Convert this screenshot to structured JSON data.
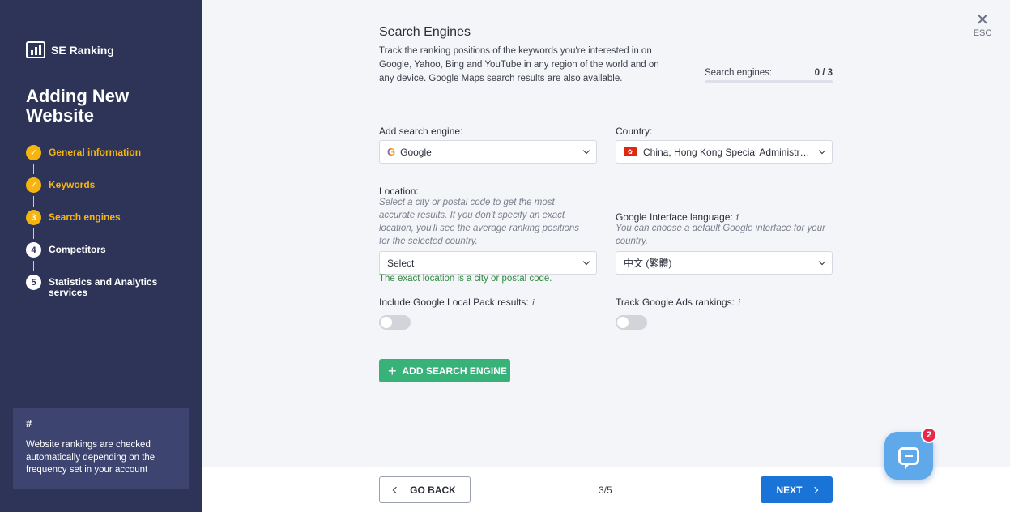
{
  "sidebar": {
    "logo_text": "SE Ranking",
    "title": "Adding New Website",
    "steps": [
      {
        "number": "✓",
        "label": "General information",
        "state": "done"
      },
      {
        "number": "✓",
        "label": "Keywords",
        "state": "done"
      },
      {
        "number": "3",
        "label": "Search engines",
        "state": "active"
      },
      {
        "number": "4",
        "label": "Competitors",
        "state": "todo"
      },
      {
        "number": "5",
        "label": "Statistics and Analytics services",
        "state": "todo"
      }
    ],
    "info_box": {
      "symbol": "#",
      "text": "Website rankings are checked automatically depending on the frequency set in your account"
    }
  },
  "close": {
    "icon": "close-icon",
    "symbol": "✕",
    "label": "ESC"
  },
  "header": {
    "title": "Search Engines",
    "description": "Track the ranking positions of the keywords you're interested in on Google, Yahoo, Bing and YouTube in any region of the world and on any device. Google Maps search results are also available.",
    "engines_label": "Search engines:",
    "engines_value": "0 / 3"
  },
  "form": {
    "engine_label": "Add search engine:",
    "engine_icon": "G",
    "engine_value": "Google",
    "country_label": "Country:",
    "country_flag": "✿",
    "country_value": "China, Hong Kong Special Administrative Region",
    "location_label": "Location:",
    "location_hint": "Select a city or postal code to get the most accurate results. If you don't specify an exact location, you'll see the average ranking positions for the selected country.",
    "location_value": "Select",
    "location_note": "The exact location is a city or postal code.",
    "language_label": "Google Interface language:",
    "language_hint": "You can choose a default Google interface for your country.",
    "language_value": "中文 (繁體)",
    "info_symbol": "i",
    "local_pack_label": "Include Google Local Pack results:",
    "local_pack_on": false,
    "ads_label": "Track Google Ads rankings:",
    "ads_on": false,
    "add_button_icon": "+",
    "add_button_label": "ADD SEARCH ENGINE"
  },
  "footer": {
    "back_label": "GO BACK",
    "page_indicator": "3/5",
    "next_label": "NEXT"
  },
  "chat": {
    "icon": "chat-icon",
    "badge": "2"
  },
  "colors": {
    "sidebar_bg": "#2e3458",
    "accent_yellow": "#f6b40e",
    "add_button": "#39b27a",
    "next_button": "#1a73d6",
    "note_green": "#2e8b3e",
    "chat_bg": "#5fa8ea",
    "badge_red": "#e8294a"
  }
}
